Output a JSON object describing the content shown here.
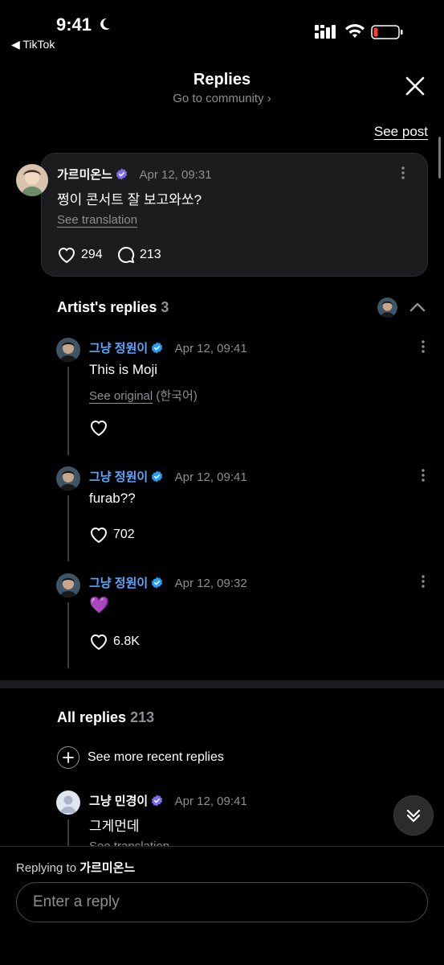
{
  "status": {
    "time": "9:41",
    "back_app": "◀ TikTok"
  },
  "header": {
    "title": "Replies",
    "subtitle": "Go to community ›",
    "see_post": "See post"
  },
  "main_comment": {
    "author": "가르미온느",
    "date": "Apr 12, 09:31",
    "text": "쩡이 콘서트 잘 보고와쏘?",
    "translation_link": "See translation",
    "likes": "294",
    "comments": "213"
  },
  "artist_replies": {
    "title": "Artist's replies",
    "count": "3",
    "items": [
      {
        "author": "그냥 정원이",
        "date": "Apr 12, 09:41",
        "text": "This is Moji",
        "original_link": "See original",
        "original_lang": "(한국어)",
        "likes": ""
      },
      {
        "author": "그냥 정원이",
        "date": "Apr 12, 09:41",
        "text": "furab??",
        "likes": "702"
      },
      {
        "author": "그냥 정원이",
        "date": "Apr 12, 09:32",
        "text": "💜",
        "likes": "6.8K"
      }
    ]
  },
  "all_replies": {
    "title": "All replies",
    "count": "213",
    "more_label": "See more recent replies",
    "items": [
      {
        "author": "그냥 민경이",
        "date": "Apr 12, 09:41",
        "text": "그게먼데",
        "translation_link": "See translation"
      }
    ]
  },
  "composer": {
    "replying_prefix": "Replying to",
    "replying_to": "가르미온느",
    "placeholder": "Enter a reply"
  },
  "colors": {
    "accent": "#5aa7ff",
    "verified_purple": "#7b6cf6",
    "verified_blue": "#1fa1ff",
    "muted": "#8e8e93"
  }
}
